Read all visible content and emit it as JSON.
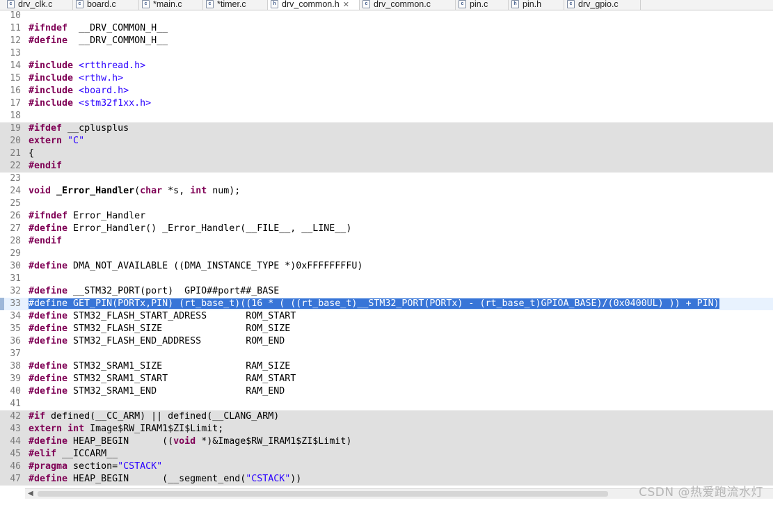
{
  "tabs": [
    {
      "label": "drv_clk.c",
      "icon": "c-file-icon",
      "badge": "c"
    },
    {
      "label": "board.c",
      "icon": "c-file-icon",
      "badge": "c"
    },
    {
      "label": "*main.c",
      "icon": "c-file-icon",
      "badge": "c"
    },
    {
      "label": "*timer.c",
      "icon": "c-file-icon",
      "badge": "c"
    },
    {
      "label": "drv_common.h",
      "icon": "h-file-icon",
      "badge": "h",
      "active": true,
      "close": "✕"
    },
    {
      "label": "drv_common.c",
      "icon": "c-file-icon",
      "badge": "c"
    },
    {
      "label": "pin.c",
      "icon": "c-file-icon",
      "badge": "c"
    },
    {
      "label": "pin.h",
      "icon": "h-file-icon",
      "badge": "h"
    },
    {
      "label": "drv_gpio.c",
      "icon": "c-file-icon",
      "badge": "c"
    }
  ],
  "editor": {
    "colors": {
      "keyword": "#7f0055",
      "string": "#2a00ff",
      "selection": "#3875d7",
      "inactive_block": "#e0e0e0"
    },
    "selected_line": 33,
    "lines": [
      {
        "n": "10",
        "t": []
      },
      {
        "n": "11",
        "t": [
          [
            "kw",
            "#ifndef"
          ],
          [
            "",
            "  __DRV_COMMON_H__"
          ]
        ]
      },
      {
        "n": "12",
        "t": [
          [
            "kw",
            "#define"
          ],
          [
            "",
            "  __DRV_COMMON_H__"
          ]
        ]
      },
      {
        "n": "13",
        "t": []
      },
      {
        "n": "14",
        "t": [
          [
            "kw",
            "#include"
          ],
          [
            "str",
            " <rtthread.h>"
          ]
        ]
      },
      {
        "n": "15",
        "t": [
          [
            "kw",
            "#include"
          ],
          [
            "str",
            " <rthw.h>"
          ]
        ]
      },
      {
        "n": "16",
        "t": [
          [
            "kw",
            "#include"
          ],
          [
            "str",
            " <board.h>"
          ]
        ]
      },
      {
        "n": "17",
        "t": [
          [
            "kw",
            "#include"
          ],
          [
            "str",
            " <stm32f1xx.h>"
          ]
        ]
      },
      {
        "n": "18",
        "t": []
      },
      {
        "n": "19",
        "gray": true,
        "t": [
          [
            "kw",
            "#ifdef"
          ],
          [
            "",
            " __cplusplus"
          ]
        ]
      },
      {
        "n": "20",
        "gray": true,
        "t": [
          [
            "kw",
            "extern"
          ],
          [
            "str",
            " \"C\""
          ]
        ]
      },
      {
        "n": "21",
        "gray": true,
        "t": [
          [
            "",
            "{"
          ]
        ]
      },
      {
        "n": "22",
        "gray": true,
        "t": [
          [
            "kw",
            "#endif"
          ]
        ]
      },
      {
        "n": "23",
        "t": []
      },
      {
        "n": "24",
        "t": [
          [
            "kw",
            "void"
          ],
          [
            "",
            " "
          ],
          [
            "b",
            "_Error_Handler"
          ],
          [
            "",
            "("
          ],
          [
            "kw",
            "char"
          ],
          [
            "",
            " *s, "
          ],
          [
            "kw",
            "int"
          ],
          [
            "",
            " num);"
          ]
        ]
      },
      {
        "n": "25",
        "t": []
      },
      {
        "n": "26",
        "t": [
          [
            "kw",
            "#ifndef"
          ],
          [
            "",
            " Error_Handler"
          ]
        ]
      },
      {
        "n": "27",
        "t": [
          [
            "kw",
            "#define"
          ],
          [
            "",
            " Error_Handler() _Error_Handler(__FILE__, __LINE__)"
          ]
        ]
      },
      {
        "n": "28",
        "t": [
          [
            "kw",
            "#endif"
          ]
        ]
      },
      {
        "n": "29",
        "t": []
      },
      {
        "n": "30",
        "t": [
          [
            "kw",
            "#define"
          ],
          [
            "",
            " DMA_NOT_AVAILABLE ((DMA_INSTANCE_TYPE *)0xFFFFFFFFU)"
          ]
        ]
      },
      {
        "n": "31",
        "t": []
      },
      {
        "n": "32",
        "t": [
          [
            "kw",
            "#define"
          ],
          [
            "",
            " __STM32_PORT(port)  GPIO##port##_BASE"
          ]
        ]
      },
      {
        "n": "33",
        "current": true,
        "t": [
          [
            "sel",
            "#define GET_PIN(PORTx,PIN) (rt_base_t)((16 * ( ((rt_base_t)__STM32_PORT(PORTx) - (rt_base_t)GPIOA_BASE)/(0x0400UL) )) + PIN)"
          ]
        ]
      },
      {
        "n": "34",
        "t": [
          [
            "kw",
            "#define"
          ],
          [
            "",
            " STM32_FLASH_START_ADRESS       ROM_START"
          ]
        ]
      },
      {
        "n": "35",
        "t": [
          [
            "kw",
            "#define"
          ],
          [
            "",
            " STM32_FLASH_SIZE               ROM_SIZE"
          ]
        ]
      },
      {
        "n": "36",
        "t": [
          [
            "kw",
            "#define"
          ],
          [
            "",
            " STM32_FLASH_END_ADDRESS        ROM_END"
          ]
        ]
      },
      {
        "n": "37",
        "t": []
      },
      {
        "n": "38",
        "t": [
          [
            "kw",
            "#define"
          ],
          [
            "",
            " STM32_SRAM1_SIZE               RAM_SIZE"
          ]
        ]
      },
      {
        "n": "39",
        "t": [
          [
            "kw",
            "#define"
          ],
          [
            "",
            " STM32_SRAM1_START              RAM_START"
          ]
        ]
      },
      {
        "n": "40",
        "t": [
          [
            "kw",
            "#define"
          ],
          [
            "",
            " STM32_SRAM1_END                RAM_END"
          ]
        ]
      },
      {
        "n": "41",
        "t": []
      },
      {
        "n": "42",
        "gray": true,
        "t": [
          [
            "kw",
            "#if"
          ],
          [
            "",
            " defined(__CC_ARM) || defined(__CLANG_ARM)"
          ]
        ]
      },
      {
        "n": "43",
        "gray": true,
        "t": [
          [
            "kw",
            "extern"
          ],
          [
            "",
            " "
          ],
          [
            "kw",
            "int"
          ],
          [
            "",
            " Image$RW_IRAM1$ZI$Limit;"
          ]
        ]
      },
      {
        "n": "44",
        "gray": true,
        "t": [
          [
            "kw",
            "#define"
          ],
          [
            "",
            " HEAP_BEGIN      (("
          ],
          [
            "kw",
            "void"
          ],
          [
            "",
            " *)&Image$RW_IRAM1$ZI$Limit)"
          ]
        ]
      },
      {
        "n": "45",
        "gray": true,
        "t": [
          [
            "kw",
            "#elif"
          ],
          [
            "",
            " __ICCARM__"
          ]
        ]
      },
      {
        "n": "46",
        "gray": true,
        "t": [
          [
            "kw",
            "#pragma"
          ],
          [
            "",
            " section="
          ],
          [
            "str",
            "\"CSTACK\""
          ]
        ]
      },
      {
        "n": "47",
        "gray": true,
        "t": [
          [
            "kw",
            "#define"
          ],
          [
            "",
            " HEAP_BEGIN      (__segment_end("
          ],
          [
            "str",
            "\"CSTACK\""
          ],
          [
            "",
            "))"
          ]
        ]
      }
    ]
  },
  "scrollbar": {
    "left_arrow": "◀"
  },
  "watermark": "CSDN @热爱跑流水灯"
}
